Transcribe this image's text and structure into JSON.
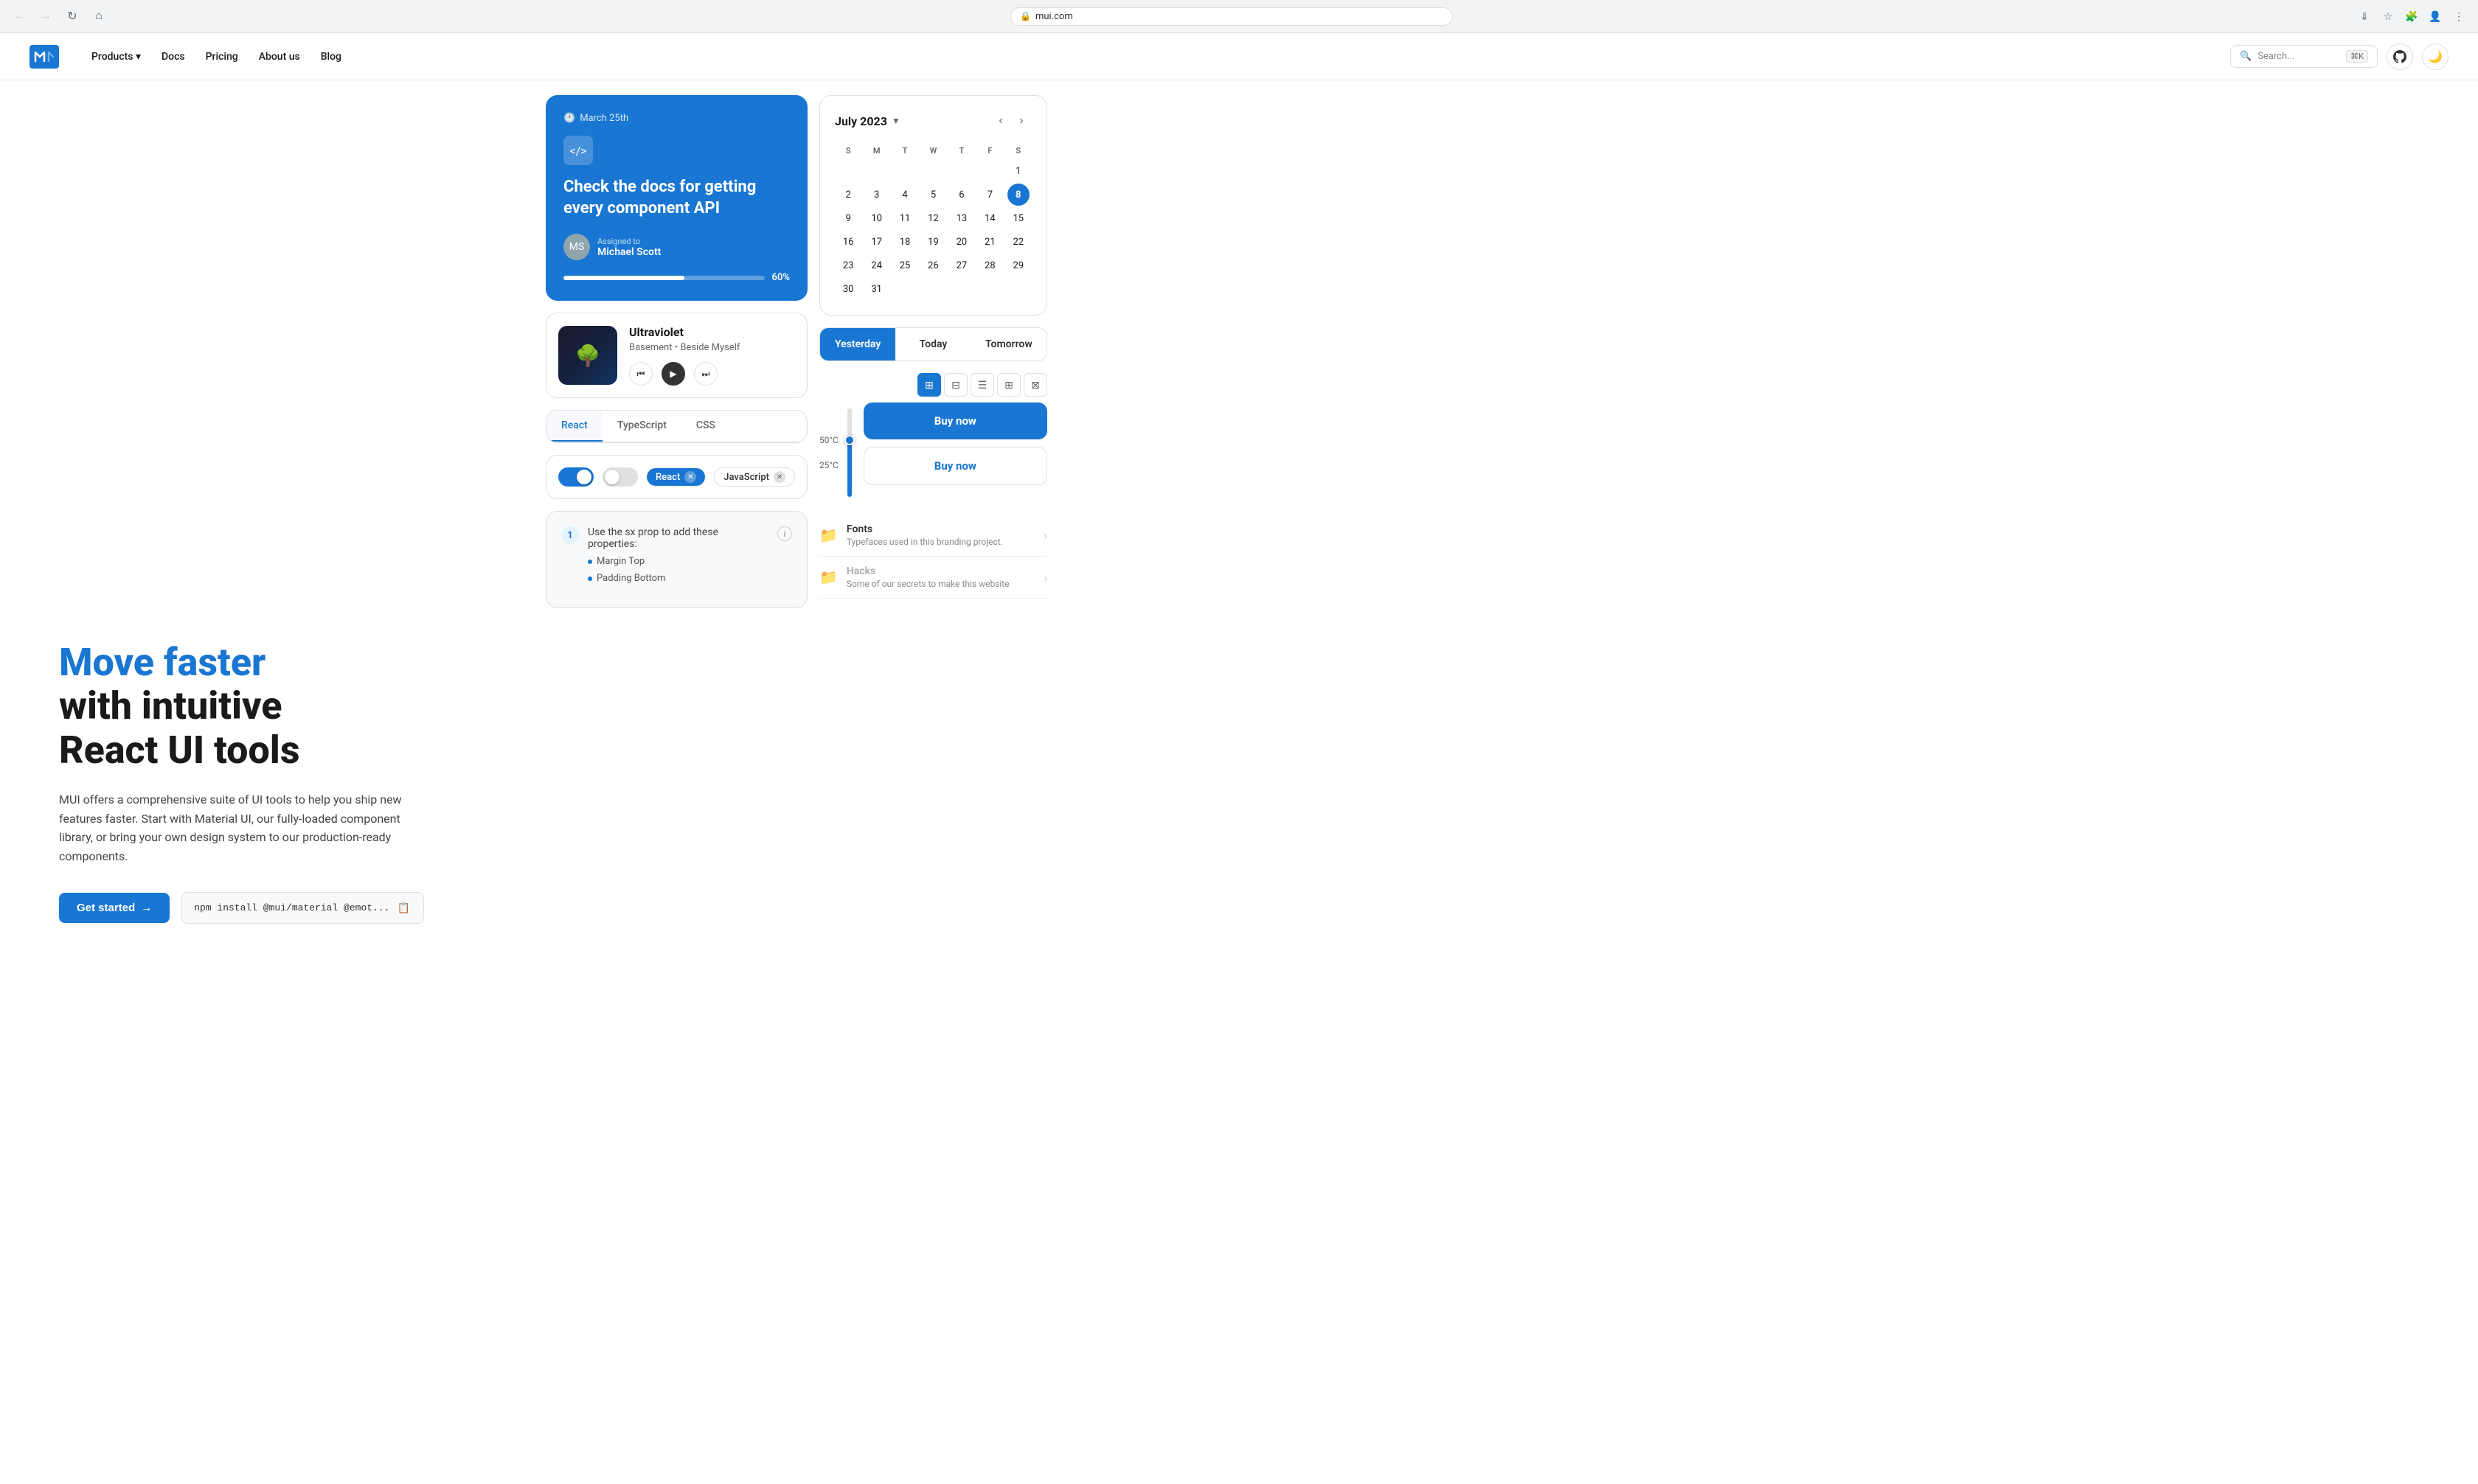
{
  "browser": {
    "url": "mui.com",
    "back_disabled": true,
    "forward_disabled": true
  },
  "header": {
    "logo_alt": "MUI Logo",
    "nav_items": [
      "Products",
      "Docs",
      "Pricing",
      "About us",
      "Blog"
    ],
    "search_placeholder": "Search...",
    "search_shortcut": "⌘K"
  },
  "hero": {
    "title_blue": "Move faster",
    "title_dark": "with intuitive\nReact UI tools",
    "subtitle": "MUI offers a comprehensive suite of UI tools to help you ship new features faster. Start with Material UI, our fully-loaded component library, or bring your own design system to our production-ready components.",
    "cta_button": "Get started",
    "code_snippet": "npm install @mui/material @emot...",
    "copy_tooltip": "Copy"
  },
  "task_card": {
    "date": "March 25th",
    "icon": "</>",
    "title": "Check the docs for getting every component API",
    "assigned_label": "Assigned to",
    "assignee": "Michael Scott",
    "progress": 60,
    "progress_label": "60%"
  },
  "music_card": {
    "title": "Ultraviolet",
    "artist": "Basement • Beside Myself"
  },
  "code_tabs": {
    "tabs": [
      "React",
      "TypeScript",
      "CSS"
    ],
    "active": "React"
  },
  "toggles": {
    "toggle1_on": true,
    "toggle2_on": false,
    "chip1_label": "React",
    "chip2_label": "JavaScript"
  },
  "num_list": {
    "item_num": "1",
    "item_text": "Use the sx prop to add these properties:",
    "sub_items": [
      "Margin Top",
      "Padding Bottom"
    ]
  },
  "calendar": {
    "month": "July 2023",
    "days_of_week": [
      "S",
      "M",
      "T",
      "W",
      "T",
      "F",
      "S"
    ],
    "today": 8,
    "weeks": [
      [
        null,
        null,
        null,
        null,
        null,
        null,
        1
      ],
      [
        2,
        3,
        4,
        5,
        6,
        7,
        8
      ],
      [
        9,
        10,
        11,
        12,
        13,
        14,
        15
      ],
      [
        16,
        17,
        18,
        19,
        20,
        21,
        22
      ],
      [
        23,
        24,
        25,
        26,
        27,
        28,
        29
      ],
      [
        30,
        31,
        null,
        null,
        null,
        null,
        null
      ]
    ]
  },
  "date_tabs": {
    "tabs": [
      "Yesterday",
      "Today",
      "Tomorrow"
    ],
    "active": "Yesterday"
  },
  "view_toggle": {
    "views": [
      "grid1",
      "grid2",
      "list",
      "grid3",
      "grid4"
    ],
    "active": 0
  },
  "buy_cards": {
    "primary_label": "Buy now",
    "secondary_label": "Buy now"
  },
  "temp_slider": {
    "high": "50°C",
    "low": "25°C"
  },
  "folders": {
    "fonts": {
      "name": "Fonts",
      "description": "Typefaces used in this branding project."
    },
    "hacks": {
      "name": "Hacks",
      "description": "Some of our secrets to make this website"
    }
  }
}
